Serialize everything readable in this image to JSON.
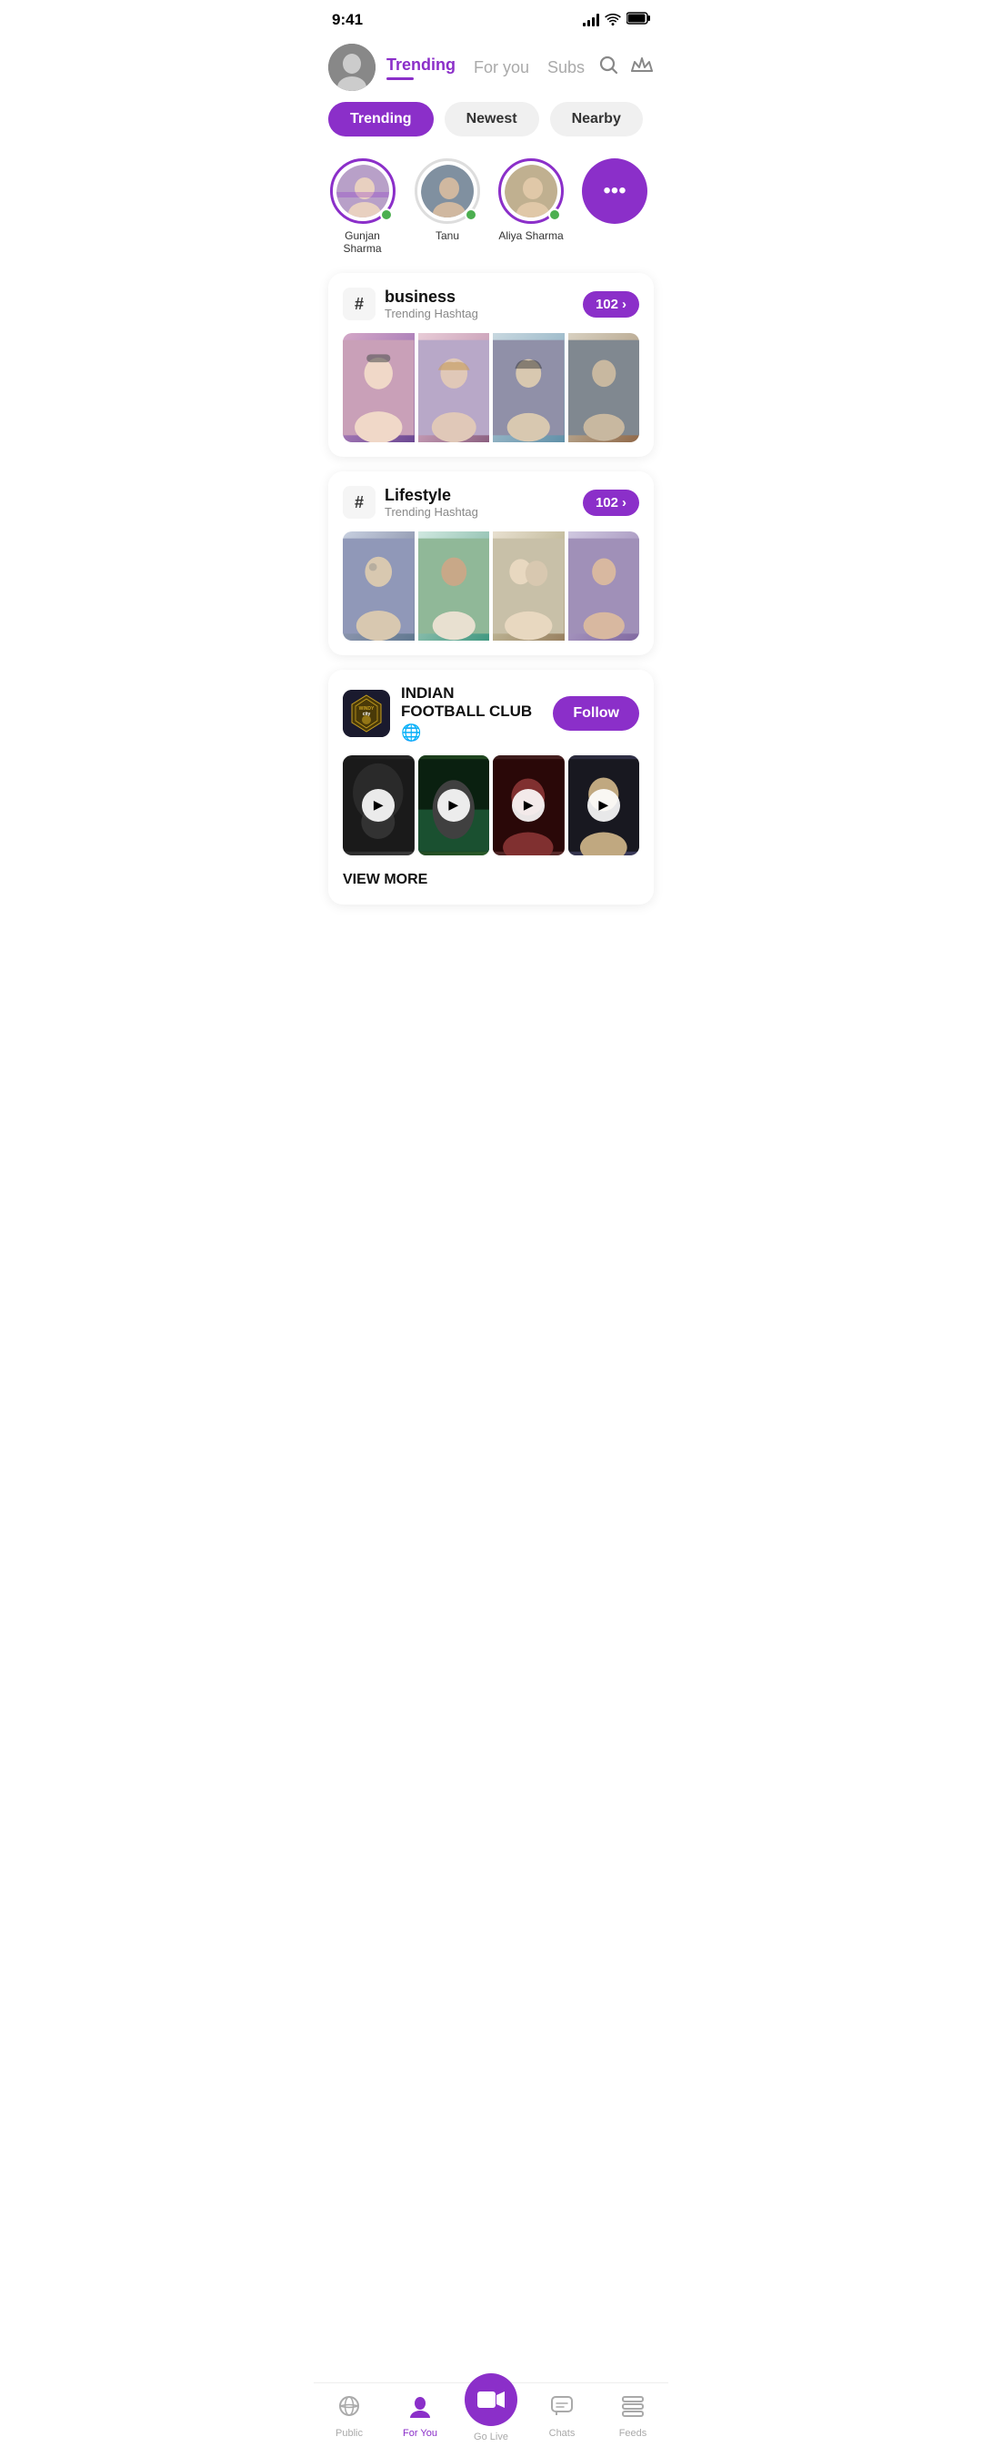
{
  "statusBar": {
    "time": "9:41",
    "signal": 4,
    "wifi": true,
    "battery": "full"
  },
  "header": {
    "tabs": [
      {
        "id": "trending",
        "label": "Trending",
        "active": true
      },
      {
        "id": "foryou",
        "label": "For you",
        "active": false
      },
      {
        "id": "subs",
        "label": "Subs",
        "active": false
      }
    ],
    "searchLabel": "search",
    "crownLabel": "crown"
  },
  "filters": [
    {
      "id": "trending",
      "label": "Trending",
      "active": true
    },
    {
      "id": "newest",
      "label": "Newest",
      "active": false
    },
    {
      "id": "nearby",
      "label": "Nearby",
      "active": false
    }
  ],
  "stories": [
    {
      "id": "gunjan",
      "name": "Gunjan Sharma",
      "online": true,
      "hasRing": true
    },
    {
      "id": "tanu",
      "name": "Tanu",
      "online": true,
      "hasRing": false
    },
    {
      "id": "aliya",
      "name": "Aliya Sharma",
      "online": true,
      "hasRing": true
    },
    {
      "id": "more",
      "name": "",
      "isMore": true
    }
  ],
  "hashtags": [
    {
      "id": "business",
      "tag": "business",
      "sub": "Trending Hashtag",
      "count": "102",
      "images": [
        "img-p1",
        "img-p2",
        "img-p3",
        "img-p4"
      ]
    },
    {
      "id": "lifestyle",
      "tag": "Lifestyle",
      "sub": "Trending Hashtag",
      "count": "102",
      "images": [
        "img-l1",
        "img-l2",
        "img-l3",
        "img-l4"
      ]
    }
  ],
  "club": {
    "name": "INDIAN FOOTBALL CLUB",
    "logoText": "WINDY\ncity",
    "globe": "🌐",
    "followLabel": "Follow",
    "viewMoreLabel": "VIEW MORE",
    "videos": [
      {
        "id": "v1",
        "bg": "cv1"
      },
      {
        "id": "v2",
        "bg": "cv2"
      },
      {
        "id": "v3",
        "bg": "cv3"
      },
      {
        "id": "v4",
        "bg": "cv4"
      }
    ]
  },
  "bottomNav": [
    {
      "id": "public",
      "label": "Public",
      "icon": "public",
      "active": false
    },
    {
      "id": "foryou",
      "label": "For You",
      "icon": "person",
      "active": true
    },
    {
      "id": "golive",
      "label": "Go Live",
      "icon": "video",
      "active": false,
      "isCenter": true
    },
    {
      "id": "chats",
      "label": "Chats",
      "icon": "chat",
      "active": false
    },
    {
      "id": "feeds",
      "label": "Feeds",
      "icon": "feeds",
      "active": false
    }
  ],
  "colors": {
    "primary": "#8B2FC9",
    "online": "#4CAF50",
    "inactive": "#aaaaaa",
    "cardBg": "#ffffff"
  }
}
